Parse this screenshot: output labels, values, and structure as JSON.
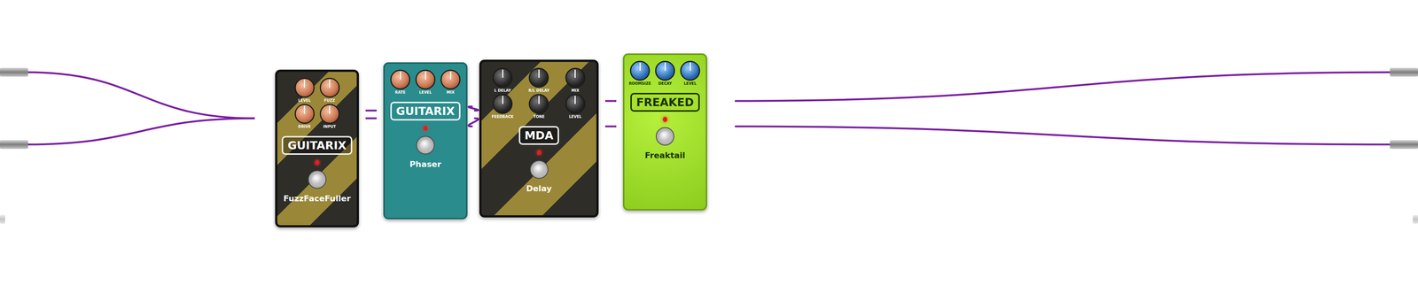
{
  "pedalboard": {
    "inputs": [
      {
        "connected": true
      },
      {
        "connected": true
      },
      {
        "connected": false
      }
    ],
    "outputs": [
      {
        "connected": true
      },
      {
        "connected": true
      },
      {
        "connected": false
      }
    ],
    "pedals": [
      {
        "brand": "GUITARIX",
        "name": "FuzzFaceFuller",
        "kind": "stripe",
        "on": true,
        "knobs": [
          {
            "label": "LEVEL",
            "level": 0.5
          },
          {
            "label": "FUZZ",
            "level": 0.5
          },
          {
            "label": "DRIVE",
            "level": 0.5
          },
          {
            "label": "INPUT",
            "level": 0.5
          }
        ]
      },
      {
        "brand": "GUITARIX",
        "name": "Phaser",
        "kind": "teal",
        "on": true,
        "knobs": [
          {
            "label": "RATE",
            "level": 0.5
          },
          {
            "label": "LEVEL",
            "level": 0.5
          },
          {
            "label": "MIX",
            "level": 0.5
          }
        ]
      },
      {
        "brand": "MDA",
        "name": "Delay",
        "kind": "mda",
        "on": true,
        "knobs": [
          {
            "label": "L DELAY",
            "level": 0.5
          },
          {
            "label": "R/L DELAY",
            "level": 0.5
          },
          {
            "label": "MIX",
            "level": 0.5
          },
          {
            "label": "FEEDBACK",
            "level": 0.5
          },
          {
            "label": "TONE",
            "level": 0.5
          },
          {
            "label": "LEVEL",
            "level": 0.5
          }
        ]
      },
      {
        "brand": "FREAKED",
        "name": "Freaktail",
        "kind": "freaked",
        "on": true,
        "knobs": [
          {
            "label": "ROOMSIZE",
            "level": 0.5
          },
          {
            "label": "DECAY",
            "level": 0.5
          },
          {
            "label": "LEVEL",
            "level": 0.5
          }
        ]
      }
    ]
  }
}
